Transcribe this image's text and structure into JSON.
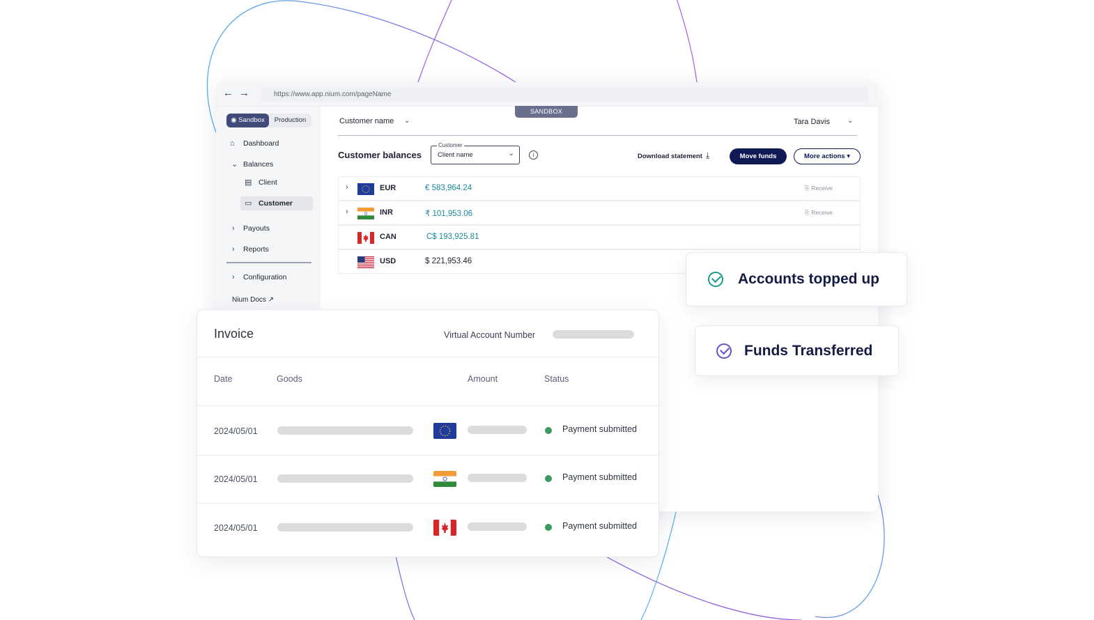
{
  "browser": {
    "url": "https://www.app.nium.com/pageName",
    "nav": {
      "back_icon": "arrow-left-icon",
      "forward_icon": "arrow-right-icon"
    }
  },
  "env_toggle": {
    "active": "Sandbox",
    "inactive": "Production"
  },
  "sidebar": {
    "items": [
      {
        "label": "Dashboard",
        "icon": "home-icon"
      },
      {
        "label": "Balances",
        "icon": "chevron-down-icon"
      },
      {
        "label": "Client",
        "icon": "document-icon"
      },
      {
        "label": "Customer",
        "icon": "wallet-icon"
      },
      {
        "label": "Payouts",
        "icon": "chevron-right-icon"
      },
      {
        "label": "Reports",
        "icon": "chevron-right-icon"
      },
      {
        "label": "Configuration",
        "icon": "chevron-right-icon"
      },
      {
        "label": "Nium Docs ↗",
        "icon": "external-link-icon"
      }
    ]
  },
  "header": {
    "sandbox_tag": "SANDBOX",
    "customer_name": "Customer name",
    "user_name": "Tara Davis"
  },
  "balances": {
    "title": "Customer balances",
    "customer_select": {
      "legend": "Customer",
      "value": "Client name"
    },
    "download_label": "Download statement",
    "move_funds_label": "Move funds",
    "more_actions_label": "More actions",
    "rows": [
      {
        "code": "EUR",
        "amount": "€ 583,964.24",
        "receive": "Receive",
        "flag": "eu-flag"
      },
      {
        "code": "INR",
        "amount": "₹ 101,953.06",
        "receive": "Receive",
        "flag": "india-flag"
      },
      {
        "code": "CAN",
        "amount": "C$ 193,925.81",
        "receive": "",
        "flag": "canada-flag"
      },
      {
        "code": "USD",
        "amount": "$ 221,953.46",
        "receive": "",
        "flag": "usa-flag"
      }
    ]
  },
  "invoice": {
    "title": "Invoice",
    "van_label": "Virtual Account Number",
    "columns": {
      "date": "Date",
      "goods": "Goods",
      "amount": "Amount",
      "status": "Status"
    },
    "rows": [
      {
        "date": "2024/05/01",
        "flag": "eu-flag",
        "status": "Payment submitted"
      },
      {
        "date": "2024/05/01",
        "flag": "india-flag",
        "status": "Payment submitted"
      },
      {
        "date": "2024/05/01",
        "flag": "canada-flag",
        "status": "Payment submitted"
      }
    ]
  },
  "toasts": {
    "topped_up": "Accounts topped up",
    "transferred": "Funds Transferred"
  },
  "colors": {
    "primary": "#0f1a55",
    "sandbox": "#3f4a78",
    "amount_teal": "#1a8a9a",
    "success_green": "#3c9a5f",
    "check_teal": "#1a9b8a",
    "check_purple": "#6a4fc8"
  }
}
